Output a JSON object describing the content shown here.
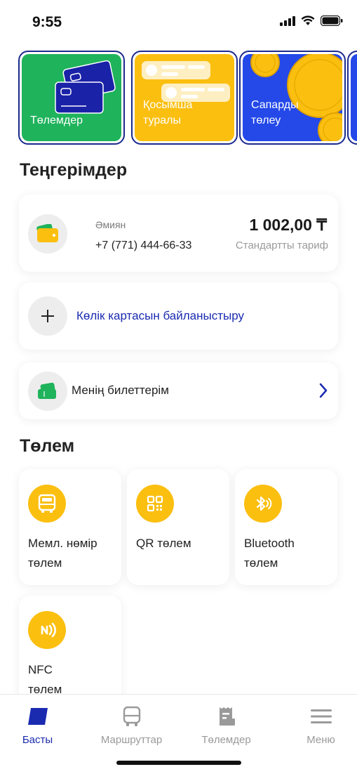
{
  "status": {
    "time": "9:55"
  },
  "stories": [
    {
      "label": "Төлемдер",
      "bg": "#1fb35c"
    },
    {
      "label": "Қосымша туралы",
      "bg": "#fbbf10"
    },
    {
      "label": "Сапарды төлеу",
      "bg": "#2449e8"
    }
  ],
  "balances": {
    "title": "Теңгерімдер",
    "wallet": {
      "name": "Әмиян",
      "phone": "+7 (771) 444-66-33",
      "balance": "1 002,00 ₸",
      "tariff": "Стандартты тариф"
    },
    "link_card_label": "Көлік картасын байланыстыру",
    "tickets_label": "Менің билеттерім"
  },
  "payment": {
    "title": "Төлем",
    "tiles": [
      {
        "label": "Мемл. нөмір төлем",
        "icon": "bus-icon"
      },
      {
        "label": "QR төлем",
        "icon": "qr-icon"
      },
      {
        "label": "Bluetooth төлем",
        "icon": "bluetooth-icon"
      },
      {
        "label": "NFC төлем",
        "icon": "nfc-icon"
      }
    ]
  },
  "nav": {
    "items": [
      {
        "label": "Басты",
        "active": true
      },
      {
        "label": "Маршруттар",
        "active": false
      },
      {
        "label": "Төлемдер",
        "active": false
      },
      {
        "label": "Меню",
        "active": false
      }
    ]
  },
  "colors": {
    "accent": "#1a2bb0",
    "yellow": "#fbbf10",
    "green": "#1fb35c",
    "blue": "#2449e8"
  }
}
